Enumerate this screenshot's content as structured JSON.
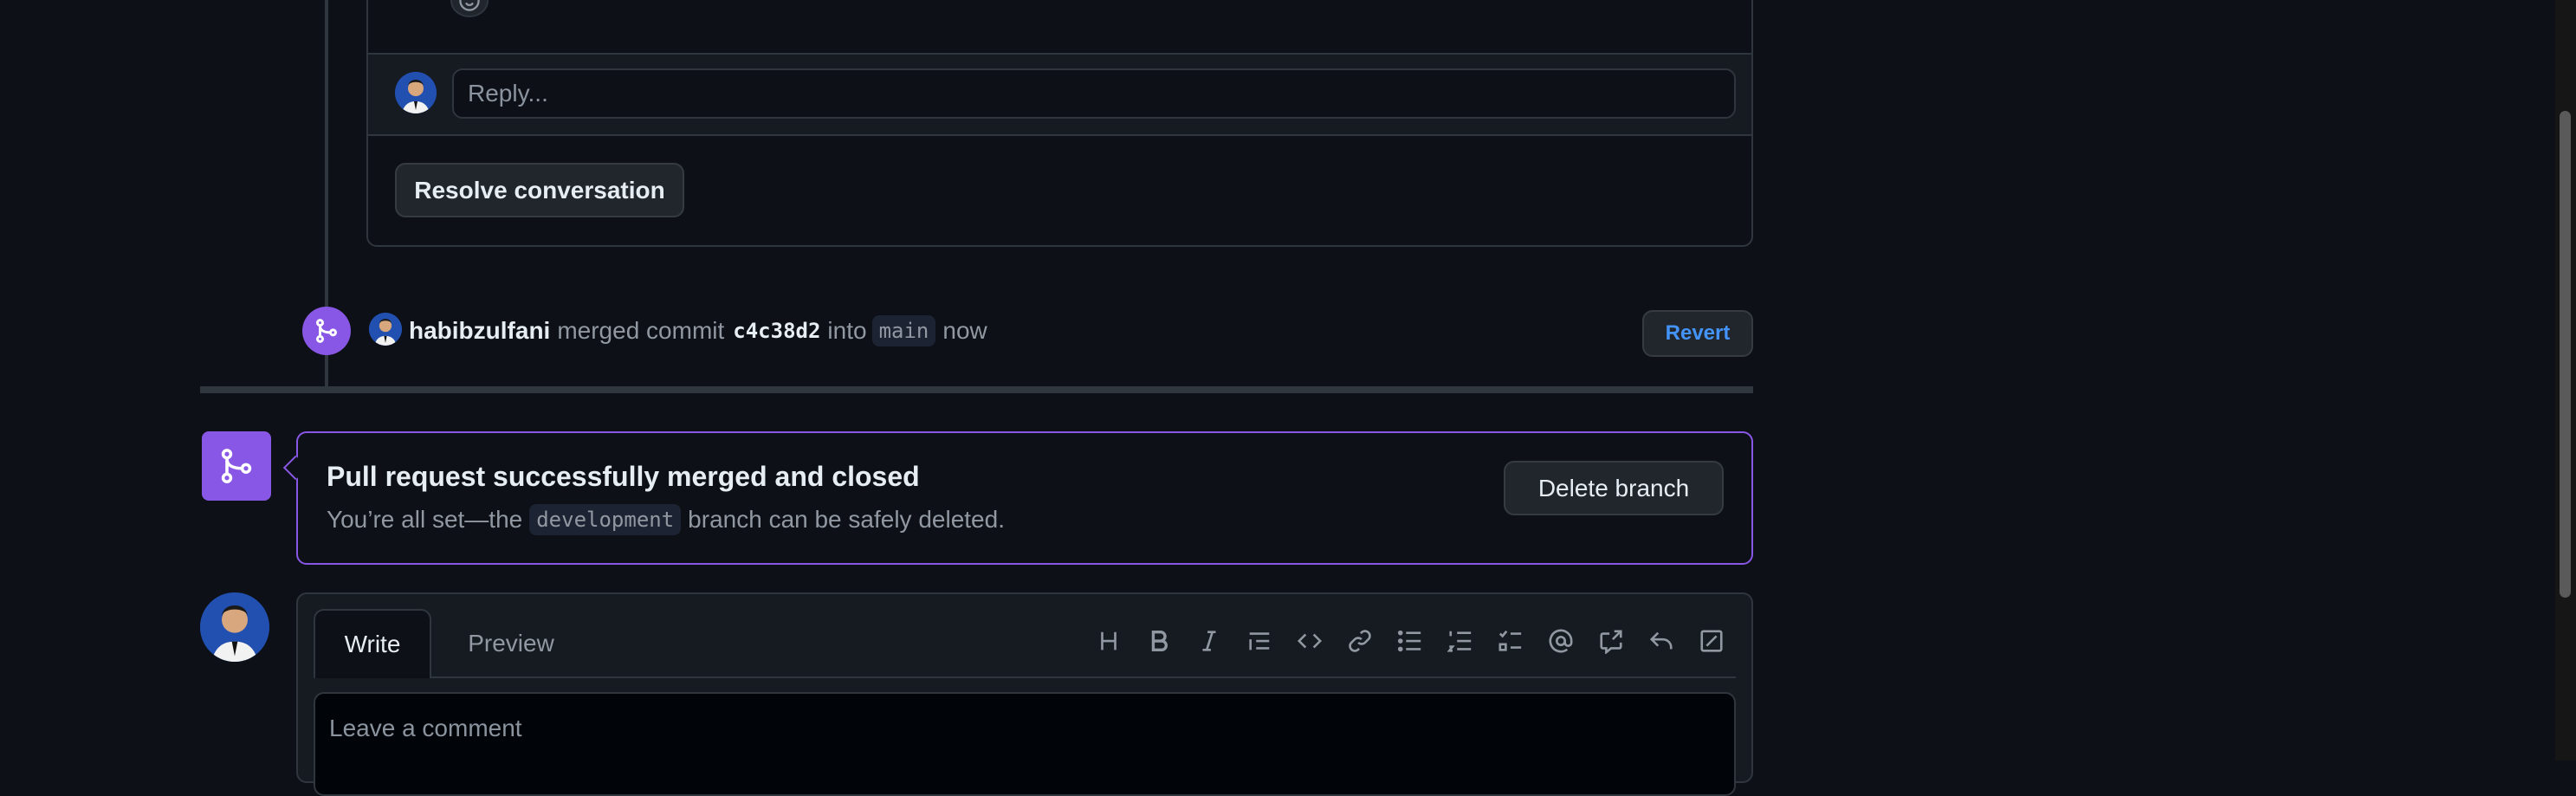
{
  "thread": {
    "reply_placeholder": "Reply...",
    "resolve_label": "Resolve conversation"
  },
  "merge_event": {
    "user": "habibzulfani",
    "action": "merged commit",
    "sha": "c4c38d2",
    "into": "into",
    "branch": "main",
    "time": "now",
    "revert_label": "Revert"
  },
  "merged_box": {
    "title": "Pull request successfully merged and closed",
    "sub_before": "You’re all set—the",
    "branch": "development",
    "sub_after": "branch can be safely deleted.",
    "delete_label": "Delete branch"
  },
  "comment": {
    "tab_write": "Write",
    "tab_preview": "Preview",
    "placeholder": "Leave a comment",
    "toolbar_icons": [
      "heading-icon",
      "bold-icon",
      "italic-icon",
      "quote-icon",
      "code-icon",
      "link-icon",
      "unordered-list-icon",
      "ordered-list-icon",
      "task-list-icon",
      "mention-icon",
      "cross-reference-icon",
      "saved-reply-icon",
      "fullscreen-icon"
    ]
  },
  "colors": {
    "background": "#0d1117",
    "border": "#30363d",
    "merged_purple": "#8957e5",
    "link_blue": "#4493f8"
  }
}
